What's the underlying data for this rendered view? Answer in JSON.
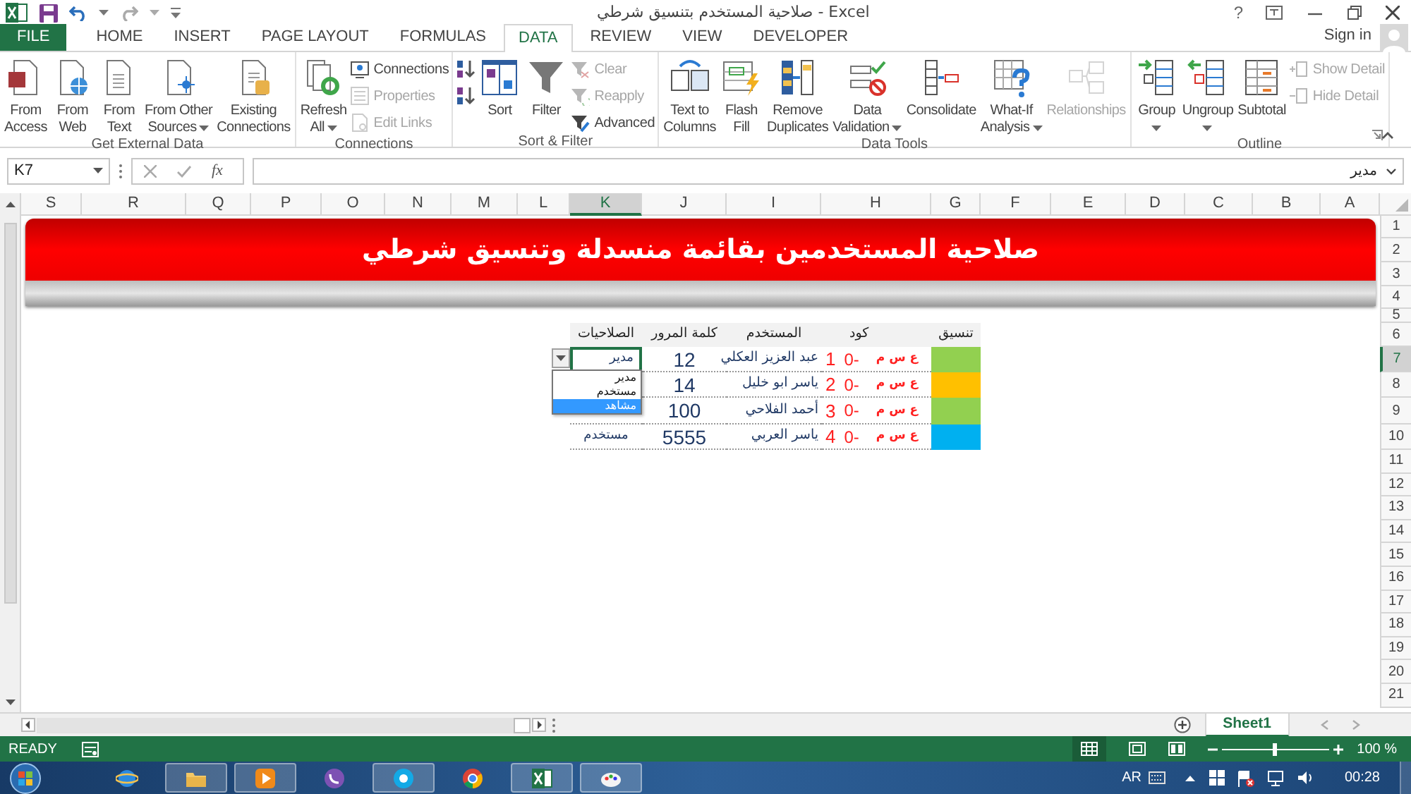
{
  "window": {
    "title": "صلاحية المستخدم بتنسيق شرطي - Excel",
    "help": "?",
    "sign_in": "Sign in"
  },
  "tabs": [
    {
      "label": "FILE",
      "kind": "file",
      "selected": false
    },
    {
      "label": "HOME",
      "kind": "tab",
      "selected": false
    },
    {
      "label": "INSERT",
      "kind": "tab",
      "selected": false
    },
    {
      "label": "PAGE LAYOUT",
      "kind": "tab",
      "selected": false
    },
    {
      "label": "FORMULAS",
      "kind": "tab",
      "selected": false
    },
    {
      "label": "DATA",
      "kind": "tab",
      "selected": true
    },
    {
      "label": "REVIEW",
      "kind": "tab",
      "selected": false
    },
    {
      "label": "VIEW",
      "kind": "tab",
      "selected": false
    },
    {
      "label": "DEVELOPER",
      "kind": "tab",
      "selected": false
    }
  ],
  "ribbon": [
    {
      "label": "Get External Data",
      "launcher": false,
      "items": [
        {
          "kind": "large",
          "lines": [
            "From",
            "Access"
          ],
          "dropdown": false,
          "disabled": false
        },
        {
          "kind": "large",
          "lines": [
            "From",
            "Web"
          ],
          "dropdown": false,
          "disabled": false
        },
        {
          "kind": "large",
          "lines": [
            "From",
            "Text"
          ],
          "dropdown": false,
          "disabled": false
        },
        {
          "kind": "large",
          "lines": [
            "From Other",
            "Sources"
          ],
          "dropdown": true,
          "disabled": false
        },
        {
          "kind": "large",
          "lines": [
            "Existing",
            "Connections"
          ],
          "dropdown": false,
          "disabled": false
        }
      ]
    },
    {
      "label": "Connections",
      "launcher": false,
      "items": [
        {
          "kind": "large",
          "lines": [
            "Refresh",
            "All"
          ],
          "dropdown": true,
          "disabled": false
        },
        {
          "kind": "small",
          "lines": [
            "Connections"
          ],
          "dropdown": false,
          "disabled": false
        },
        {
          "kind": "small",
          "lines": [
            "Properties"
          ],
          "dropdown": false,
          "disabled": true
        },
        {
          "kind": "small",
          "lines": [
            "Edit Links"
          ],
          "dropdown": false,
          "disabled": true
        }
      ]
    },
    {
      "label": "Sort & Filter",
      "launcher": false,
      "items": [
        {
          "kind": "icon",
          "dropdown": false,
          "disabled": false
        },
        {
          "kind": "icon",
          "dropdown": false,
          "disabled": false
        },
        {
          "kind": "large",
          "lines": [
            "Sort"
          ],
          "dropdown": false,
          "disabled": false
        },
        {
          "kind": "large",
          "lines": [
            "Filter"
          ],
          "dropdown": false,
          "disabled": false
        },
        {
          "kind": "small",
          "lines": [
            "Clear"
          ],
          "dropdown": false,
          "disabled": true
        },
        {
          "kind": "small",
          "lines": [
            "Reapply"
          ],
          "dropdown": false,
          "disabled": true
        },
        {
          "kind": "small",
          "lines": [
            "Advanced"
          ],
          "dropdown": false,
          "disabled": false
        }
      ]
    },
    {
      "label": "Data Tools",
      "launcher": false,
      "items": [
        {
          "kind": "large",
          "lines": [
            "Text to",
            "Columns"
          ],
          "dropdown": false,
          "disabled": false
        },
        {
          "kind": "large",
          "lines": [
            "Flash",
            "Fill"
          ],
          "dropdown": false,
          "disabled": false
        },
        {
          "kind": "large",
          "lines": [
            "Remove",
            "Duplicates"
          ],
          "dropdown": false,
          "disabled": false
        },
        {
          "kind": "large",
          "lines": [
            "Data",
            "Validation"
          ],
          "dropdown": true,
          "disabled": false
        },
        {
          "kind": "large",
          "lines": [
            "Consolidate"
          ],
          "dropdown": false,
          "disabled": false
        },
        {
          "kind": "large",
          "lines": [
            "What-If",
            "Analysis"
          ],
          "dropdown": true,
          "disabled": false
        },
        {
          "kind": "large",
          "lines": [
            "Relationships"
          ],
          "dropdown": false,
          "disabled": true
        }
      ]
    },
    {
      "label": "Outline",
      "launcher": true,
      "items": [
        {
          "kind": "large",
          "lines": [
            "Group"
          ],
          "dropdown": true,
          "disabled": false
        },
        {
          "kind": "large",
          "lines": [
            "Ungroup"
          ],
          "dropdown": true,
          "disabled": false
        },
        {
          "kind": "large",
          "lines": [
            "Subtotal"
          ],
          "dropdown": false,
          "disabled": false
        },
        {
          "kind": "small",
          "lines": [
            "Show Detail"
          ],
          "dropdown": false,
          "disabled": true
        },
        {
          "kind": "small",
          "lines": [
            "Hide Detail"
          ],
          "dropdown": false,
          "disabled": true
        }
      ]
    }
  ],
  "formula_bar": {
    "name_box": "K7",
    "fx": "fx",
    "value": "مدير"
  },
  "columns": [
    {
      "label": "S",
      "selected": false
    },
    {
      "label": "R",
      "selected": false
    },
    {
      "label": "Q",
      "selected": false
    },
    {
      "label": "P",
      "selected": false
    },
    {
      "label": "O",
      "selected": false
    },
    {
      "label": "N",
      "selected": false
    },
    {
      "label": "M",
      "selected": false
    },
    {
      "label": "L",
      "selected": false
    },
    {
      "label": "K",
      "selected": true
    },
    {
      "label": "J",
      "selected": false
    },
    {
      "label": "I",
      "selected": false
    },
    {
      "label": "H",
      "selected": false
    },
    {
      "label": "G",
      "selected": false
    },
    {
      "label": "F",
      "selected": false
    },
    {
      "label": "E",
      "selected": false
    },
    {
      "label": "D",
      "selected": false
    },
    {
      "label": "C",
      "selected": false
    },
    {
      "label": "B",
      "selected": false
    },
    {
      "label": "A",
      "selected": false
    }
  ],
  "rows": [
    {
      "label": "1",
      "selected": false
    },
    {
      "label": "2",
      "selected": false
    },
    {
      "label": "3",
      "selected": false
    },
    {
      "label": "4",
      "selected": false
    },
    {
      "label": "5",
      "selected": false
    },
    {
      "label": "6",
      "selected": false
    },
    {
      "label": "7",
      "selected": true
    },
    {
      "label": "8",
      "selected": false
    },
    {
      "label": "9",
      "selected": false
    },
    {
      "label": "10",
      "selected": false
    },
    {
      "label": "11",
      "selected": false
    },
    {
      "label": "12",
      "selected": false
    },
    {
      "label": "13",
      "selected": false
    },
    {
      "label": "14",
      "selected": false
    },
    {
      "label": "15",
      "selected": false
    },
    {
      "label": "16",
      "selected": false
    },
    {
      "label": "17",
      "selected": false
    },
    {
      "label": "18",
      "selected": false
    },
    {
      "label": "19",
      "selected": false
    },
    {
      "label": "20",
      "selected": false
    },
    {
      "label": "21",
      "selected": false
    }
  ],
  "banner": {
    "title": "صلاحية المستخدمين بقائمة منسدلة وتنسيق شرطي"
  },
  "table": {
    "headers": [
      "تنسيق",
      "كود",
      "المستخدم",
      "كلمة المرور",
      "الصلاحيات"
    ],
    "rows": [
      {
        "color": "#92d050",
        "code": "ع س م",
        "prefix": "0-",
        "number": "1",
        "user": "عبد العزيز العكلي",
        "password": "12",
        "permission": "مدير"
      },
      {
        "color": "#ffc000",
        "code": "ع س م",
        "prefix": "0-",
        "number": "2",
        "user": "ياسر ابو خليل",
        "password": "14"
      },
      {
        "color": "#92d050",
        "code": "ع س م",
        "prefix": "0-",
        "number": "3",
        "user": "أحمد الفلاحي",
        "password": "100"
      },
      {
        "color": "#00b0f0",
        "code": "ع س م",
        "prefix": "0-",
        "number": "4",
        "user": "ياسر العربي",
        "password": "5555",
        "permission": "مستخدم"
      }
    ]
  },
  "dropdown": {
    "items": [
      {
        "label": "مدير",
        "selected": false
      },
      {
        "label": "مستخدم",
        "selected": false
      },
      {
        "label": "مشاهد",
        "selected": true
      }
    ]
  },
  "sheet_tabs": [
    {
      "label": "Sheet1",
      "selected": true
    }
  ],
  "status_bar": {
    "mode": "READY",
    "zoom": "100 %",
    "zoom_slider": {
      "level": 0.5
    }
  },
  "taskbar": {
    "apps": [
      {
        "kind": "ie",
        "running": false
      },
      {
        "kind": "explorer",
        "running": true
      },
      {
        "kind": "media",
        "running": true
      },
      {
        "kind": "viber",
        "running": false
      },
      {
        "kind": "skype",
        "running": true
      },
      {
        "kind": "chrome",
        "running": false
      },
      {
        "kind": "excel",
        "running": true
      },
      {
        "kind": "paint",
        "running": true
      }
    ],
    "language": "AR",
    "time": "00:28"
  }
}
